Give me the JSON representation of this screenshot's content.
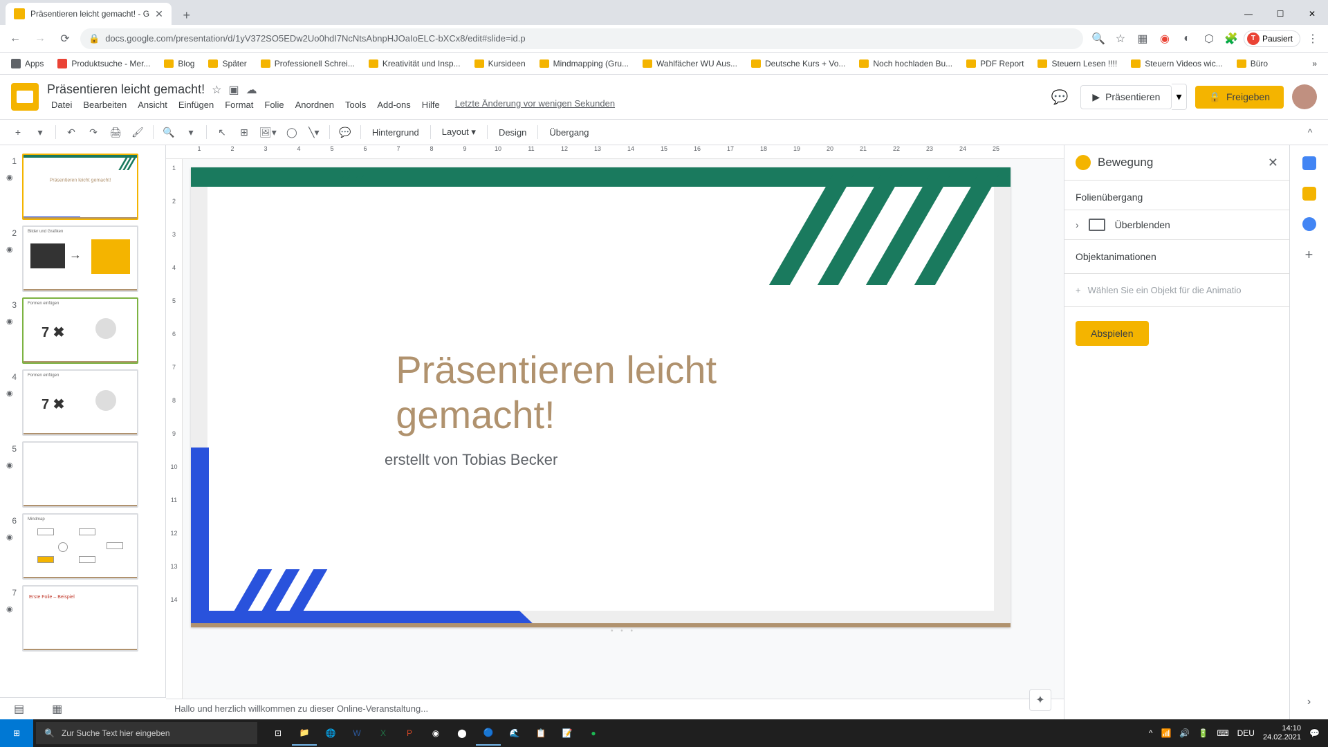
{
  "browser": {
    "tab_title": "Präsentieren leicht gemacht! - G",
    "url": "docs.google.com/presentation/d/1yV372SO5EDw2Uo0hdI7NcNtsAbnpHJOaIoELC-bXCx8/edit#slide=id.p",
    "profile_label": "Pausiert",
    "profile_initial": "T"
  },
  "bookmarks": [
    "Apps",
    "Produktsuche - Mer...",
    "Blog",
    "Später",
    "Professionell Schrei...",
    "Kreativität und Insp...",
    "Kursideen",
    "Mindmapping  (Gru...",
    "Wahlfächer WU Aus...",
    "Deutsche Kurs + Vo...",
    "Noch hochladen Bu...",
    "PDF Report",
    "Steuern Lesen !!!!",
    "Steuern Videos wic...",
    "Büro"
  ],
  "doc": {
    "title": "Präsentieren leicht gemacht!",
    "last_edit": "Letzte Änderung vor wenigen Sekunden"
  },
  "menus": [
    "Datei",
    "Bearbeiten",
    "Ansicht",
    "Einfügen",
    "Format",
    "Folie",
    "Anordnen",
    "Tools",
    "Add-ons",
    "Hilfe"
  ],
  "header_buttons": {
    "present": "Präsentieren",
    "share": "Freigeben"
  },
  "toolbar": {
    "background": "Hintergrund",
    "layout": "Layout",
    "design": "Design",
    "transition": "Übergang"
  },
  "ruler_h": [
    "1",
    "2",
    "3",
    "4",
    "5",
    "6",
    "7",
    "8",
    "9",
    "10",
    "11",
    "12",
    "13",
    "14",
    "15",
    "16",
    "17",
    "18",
    "19",
    "20",
    "21",
    "22",
    "23",
    "24",
    "25"
  ],
  "ruler_v": [
    "1",
    "2",
    "3",
    "4",
    "5",
    "6",
    "7",
    "8",
    "9",
    "10",
    "11",
    "12",
    "13",
    "14"
  ],
  "slide": {
    "title": "Präsentieren leicht gemacht!",
    "subtitle": "erstellt von Tobias Becker"
  },
  "notes": "Hallo und herzlich willkommen zu dieser Online-Veranstaltung...",
  "panel": {
    "title": "Bewegung",
    "transition_label": "Folienübergang",
    "transition_type": "Überblenden",
    "animations_label": "Objektanimationen",
    "add_object": "Wählen Sie ein Objekt für die Animatio",
    "play": "Abspielen"
  },
  "thumbs": [
    {
      "num": "1",
      "label": "Präsentieren leicht gemacht!"
    },
    {
      "num": "2",
      "label": "Bilder und Grafiken"
    },
    {
      "num": "3",
      "label": "Formen einfügen",
      "big": "7 ✖"
    },
    {
      "num": "4",
      "label": "Formen einfügen",
      "big": "7 ✖"
    },
    {
      "num": "5",
      "label": ""
    },
    {
      "num": "6",
      "label": "Mindmap"
    },
    {
      "num": "7",
      "label": "Erste Folie – Beispiel"
    }
  ],
  "taskbar": {
    "search_placeholder": "Zur Suche Text hier eingeben",
    "lang": "DEU",
    "time": "14:10",
    "date": "24.02.2021"
  },
  "colors": {
    "accent": "#f4b400",
    "green": "#1a7a5e",
    "blue": "#2952dc",
    "brown": "#b0926e"
  }
}
